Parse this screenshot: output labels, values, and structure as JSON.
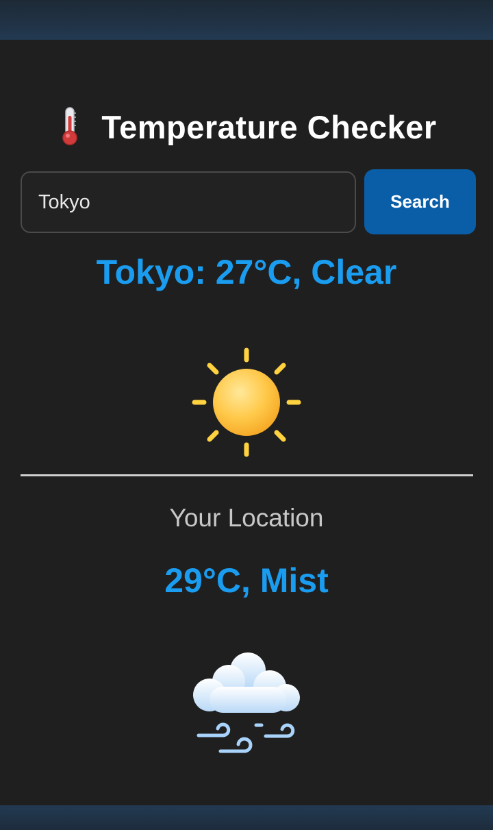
{
  "header": {
    "title": "Temperature Checker",
    "icon": "thermometer-icon"
  },
  "search": {
    "value": "Tokyo",
    "button_label": "Search"
  },
  "result": {
    "text": "Tokyo: 27°C, Clear",
    "icon": "sun-icon"
  },
  "location": {
    "label": "Your Location",
    "weather": "29°C, Mist",
    "icon": "mist-cloud-icon"
  },
  "colors": {
    "background": "#1f1f1f",
    "accent_text": "#1a9df0",
    "button": "#0a5ea8",
    "title": "#ffffff"
  }
}
